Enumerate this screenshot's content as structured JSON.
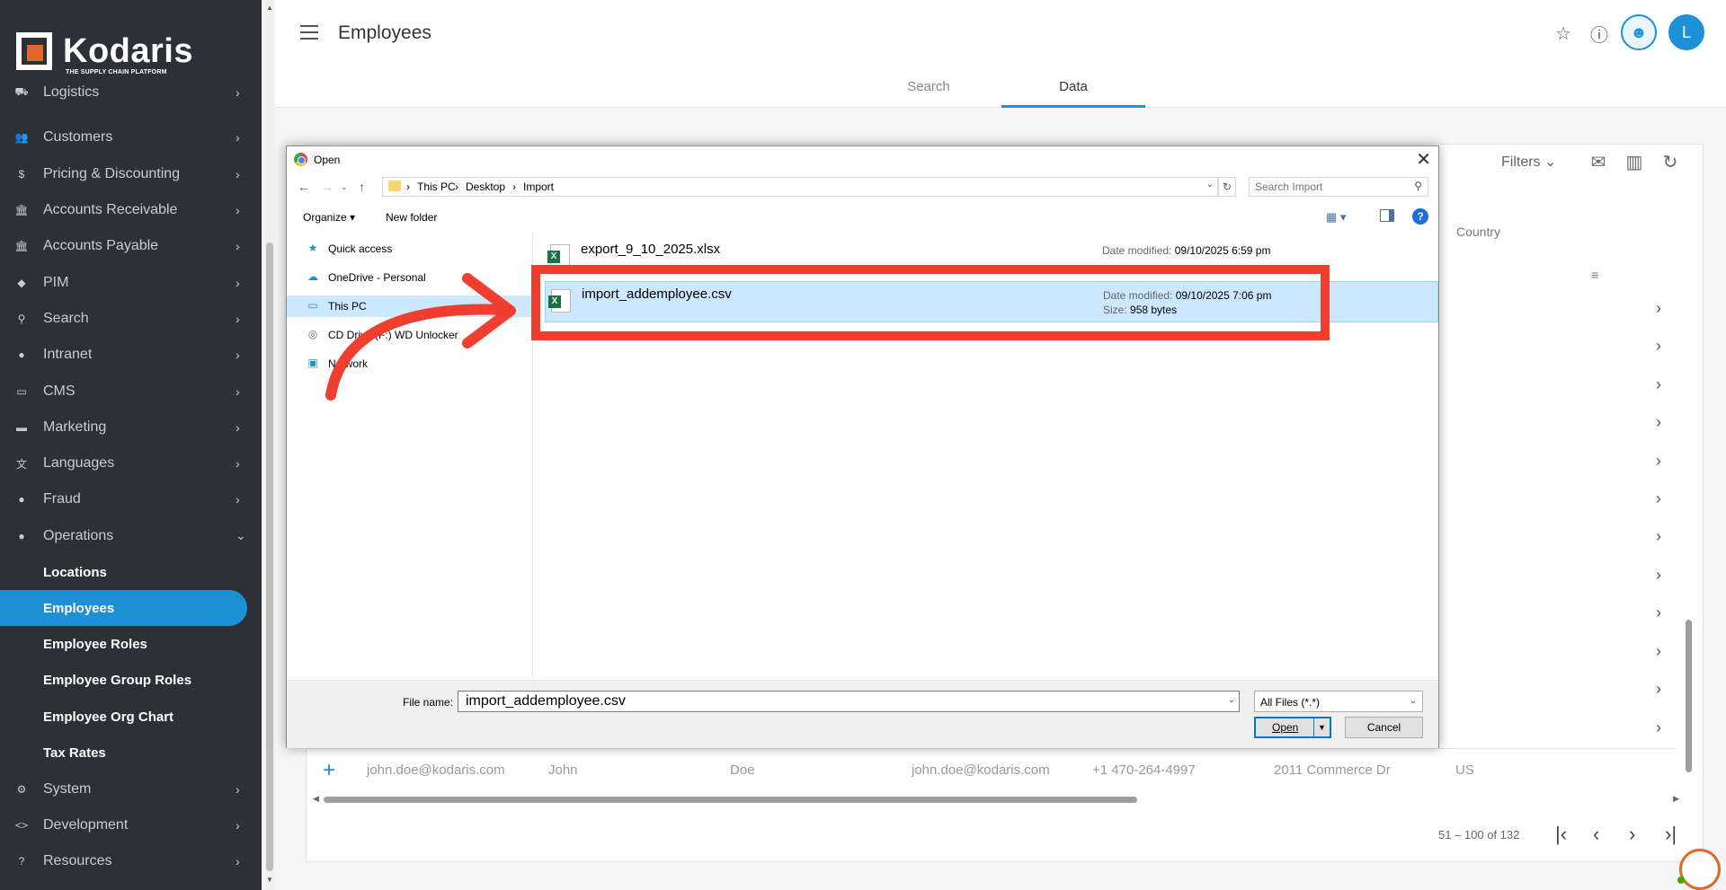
{
  "brand": {
    "name": "Kodaris",
    "tagline": "THE SUPPLY CHAIN PLATFORM",
    "accent": "#1e90d6",
    "logo_orange": "#e0662b"
  },
  "sidebar": {
    "items": [
      {
        "label": "Logistics",
        "icon": "truck-icon"
      },
      {
        "label": "Customers",
        "icon": "users-icon"
      },
      {
        "label": "Pricing & Discounting",
        "icon": "dollar-icon"
      },
      {
        "label": "Accounts Receivable",
        "icon": "bank-icon"
      },
      {
        "label": "Accounts Payable",
        "icon": "bank-icon"
      },
      {
        "label": "PIM",
        "icon": "tag-icon"
      },
      {
        "label": "Search",
        "icon": "search-icon"
      },
      {
        "label": "Intranet",
        "icon": "globe-icon"
      },
      {
        "label": "CMS",
        "icon": "cms-icon"
      },
      {
        "label": "Marketing",
        "icon": "megaphone-icon"
      },
      {
        "label": "Languages",
        "icon": "translate-icon"
      },
      {
        "label": "Fraud",
        "icon": "alert-icon"
      },
      {
        "label": "Operations",
        "icon": "operations-icon"
      },
      {
        "label": "Locations"
      },
      {
        "label": "Employees"
      },
      {
        "label": "Employee Roles"
      },
      {
        "label": "Employee Group Roles"
      },
      {
        "label": "Employee Org Chart"
      },
      {
        "label": "Tax Rates"
      },
      {
        "label": "System",
        "icon": "gear-icon"
      },
      {
        "label": "Development",
        "icon": "code-icon"
      },
      {
        "label": "Resources",
        "icon": "help-circle-icon"
      }
    ]
  },
  "header": {
    "title": "Employees",
    "avatar_letter": "L",
    "tabs": [
      "Search",
      "Data"
    ],
    "active_tab": "Data"
  },
  "table": {
    "filters_label": "Filters",
    "country_header": "Country",
    "row": {
      "email": "john.doe@kodaris.com",
      "first": "John",
      "last": "Doe",
      "email2": "john.doe@kodaris.com",
      "phone": "+1 470-264-4997",
      "address": "2011 Commerce Dr",
      "country": "US"
    },
    "pager": "51 – 100 of 132"
  },
  "dialog": {
    "title": "Open",
    "breadcrumb": [
      "This PC",
      "Desktop",
      "Import"
    ],
    "search_placeholder": "Search Import",
    "organize_label": "Organize",
    "new_folder_label": "New folder",
    "tree": [
      {
        "label": "Quick access",
        "icon": "star-icon"
      },
      {
        "label": "OneDrive - Personal",
        "icon": "cloud-icon"
      },
      {
        "label": "This PC",
        "icon": "computer-icon"
      },
      {
        "label": "CD Drive (F:) WD Unlocker",
        "icon": "disc-icon"
      },
      {
        "label": "Network",
        "icon": "network-icon"
      }
    ],
    "files": [
      {
        "name": "export_9_10_2025.xlsx",
        "date_label": "Date modified:",
        "date": "09/10/2025 6:59 pm"
      },
      {
        "name": "import_addemployee.csv",
        "date_label": "Date modified:",
        "date": "09/10/2025 7:06 pm",
        "size_label": "Size:",
        "size": "958 bytes"
      }
    ],
    "file_name_label": "File name:",
    "file_name_value": "import_addemployee.csv",
    "file_type": "All Files (*.*)",
    "open_label": "Open",
    "cancel_label": "Cancel"
  },
  "annotation_color": "#f03e2f"
}
